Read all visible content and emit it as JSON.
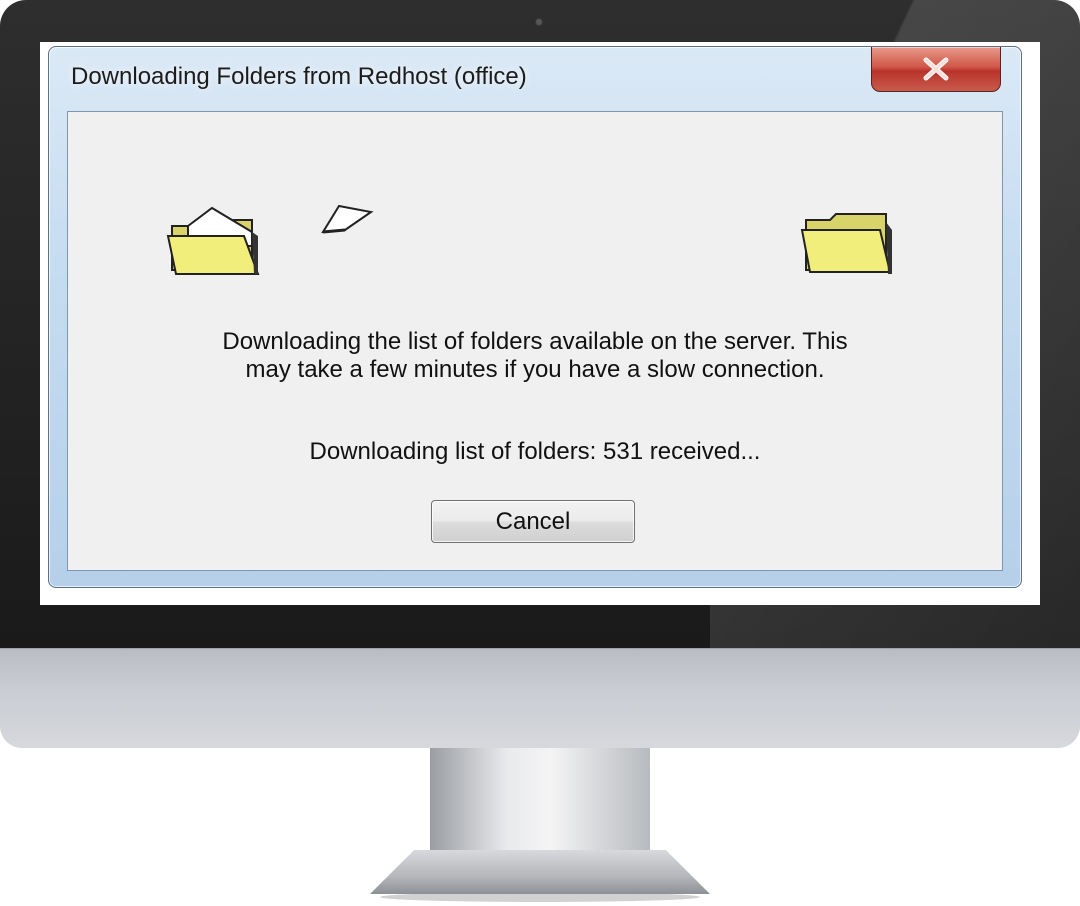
{
  "window": {
    "title": "Downloading Folders from Redhost (office)",
    "close_icon": "close-icon"
  },
  "dialog": {
    "message_line1": "Downloading the list of folders available on the server. This",
    "message_line2": "may take a few minutes if you have a slow connection.",
    "status": "Downloading list of folders: 531 received...",
    "cancel_label": "Cancel"
  },
  "icons": {
    "source_folder": "open-folder-icon",
    "flying_document": "document-icon",
    "destination_folder": "folder-icon"
  },
  "colors": {
    "folder_yellow": "#f2ee7c",
    "close_red": "#c9473b",
    "titlebar_blue": "#c6dcf0",
    "client_gray": "#f0f0f0"
  }
}
